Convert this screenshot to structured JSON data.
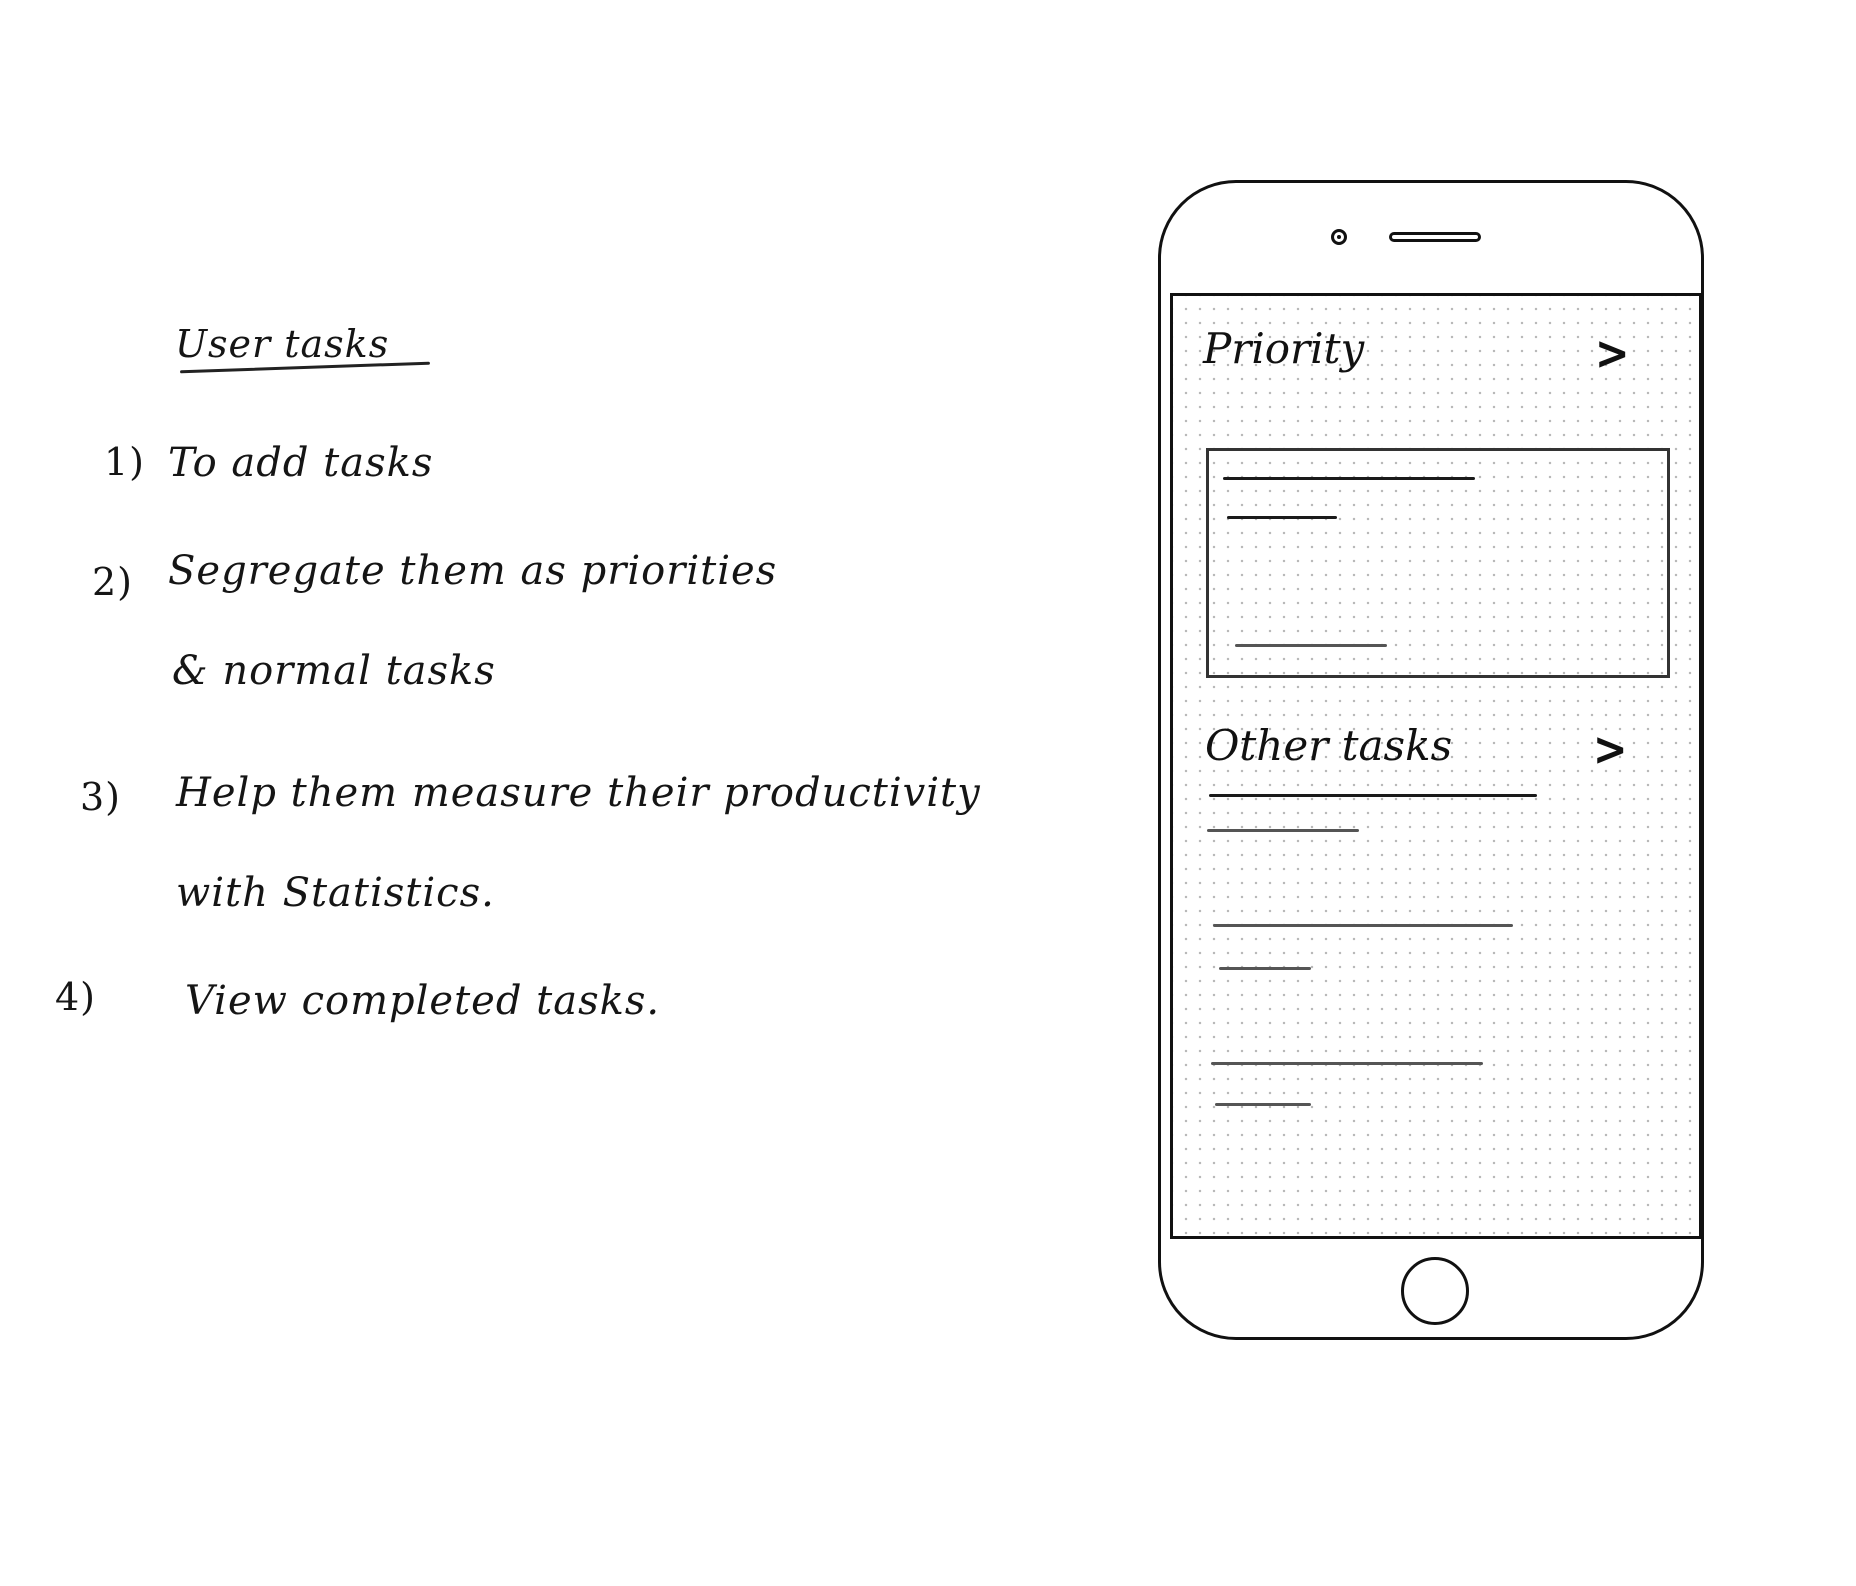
{
  "notes": {
    "heading": "User tasks",
    "items": [
      {
        "number": "1)",
        "lines": [
          "To add tasks"
        ]
      },
      {
        "number": "2)",
        "lines": [
          "Segregate them as priorities",
          "& normal tasks"
        ]
      },
      {
        "number": "3)",
        "lines": [
          "Help them measure their productivity",
          "with Statistics."
        ]
      },
      {
        "number": "4)",
        "lines": [
          "View completed tasks."
        ]
      }
    ]
  },
  "phone": {
    "priority_section": {
      "title": "Priority",
      "chevron_icon": "chevron-right-icon"
    },
    "other_section": {
      "title": "Other tasks",
      "chevron_icon": "chevron-right-icon"
    }
  }
}
